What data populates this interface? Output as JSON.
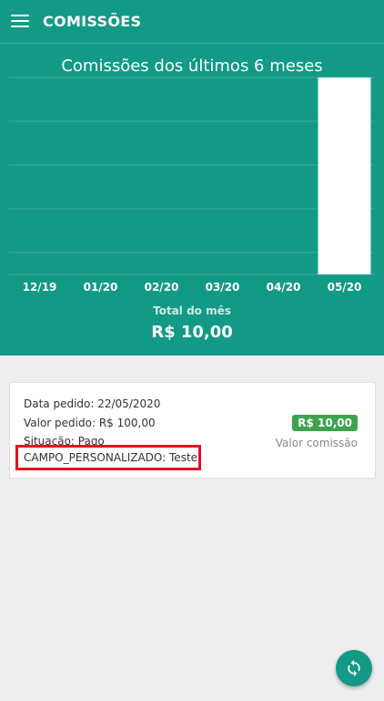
{
  "header": {
    "title": "COMISSÕES",
    "menu_icon": "hamburger-menu-icon"
  },
  "chart_data": {
    "type": "bar",
    "title": "Comissões dos últimos 6 meses",
    "categories": [
      "12/19",
      "01/20",
      "02/20",
      "03/20",
      "04/20",
      "05/20"
    ],
    "values": [
      0,
      0,
      0,
      0,
      0,
      10
    ],
    "grid": true,
    "bar_color": "#ffffff"
  },
  "summary": {
    "label": "Total do mês",
    "value": "R$ 10,00"
  },
  "commission": {
    "order_date": "Data pedido: 22/05/2020",
    "order_value": "Valor pedido: R$ 100,00",
    "status": "Situação: Pago",
    "custom_field": "CAMPO_PERSONALIZADO: Teste",
    "amount": "R$ 10,00",
    "amount_label": "Valor comissão",
    "amount_color": "#3fa34d",
    "highlight_color": "#e0141f"
  },
  "fab": {
    "icon": "refresh-icon"
  },
  "colors": {
    "primary": "#129a86",
    "background": "#eeeeee"
  }
}
